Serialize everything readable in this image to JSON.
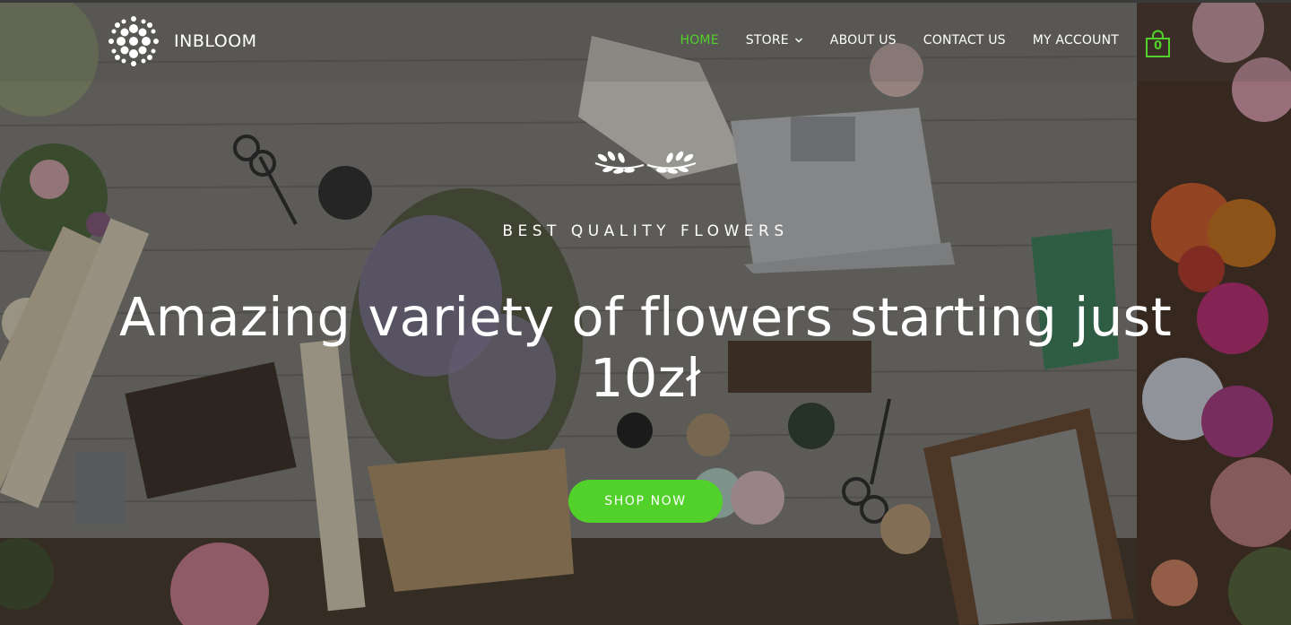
{
  "brand": {
    "name": "INBLOOM",
    "logo_icon": "flower-cluster-icon"
  },
  "nav": {
    "items": [
      {
        "label": "HOME",
        "active": true
      },
      {
        "label": "STORE",
        "has_dropdown": true
      },
      {
        "label": "ABOUT US"
      },
      {
        "label": "CONTACT US"
      },
      {
        "label": "MY ACCOUNT"
      }
    ],
    "cart": {
      "count": "0",
      "icon": "shopping-bag-icon"
    }
  },
  "hero": {
    "ornament_icon": "laurel-icon",
    "tagline": "BEST QUALITY FLOWERS",
    "headline": "Amazing variety of flowers starting just 10zł",
    "cta_label": "SHOP NOW"
  },
  "colors": {
    "accent": "#52d12b",
    "text": "#ffffff"
  }
}
